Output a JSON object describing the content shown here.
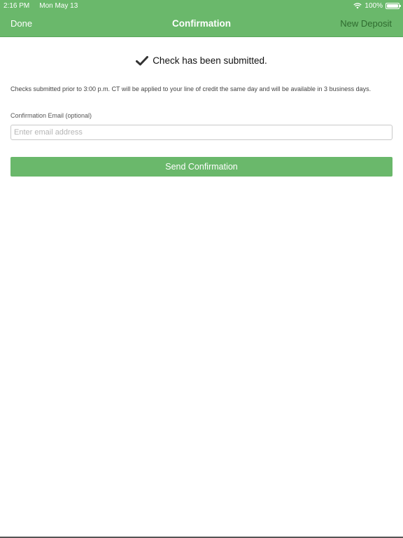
{
  "status_bar": {
    "time": "2:16 PM",
    "date": "Mon May 13",
    "battery": "100%",
    "icons": [
      "wifi-icon",
      "battery-icon"
    ]
  },
  "nav": {
    "left_label": "Done",
    "title": "Confirmation",
    "right_label": "New Deposit"
  },
  "confirmation": {
    "icon": "checkmark-icon",
    "message": "Check has been submitted.",
    "info": "Checks submitted prior to 3:00 p.m. CT will be applied to your line of credit the same day and will be available in 3 business days."
  },
  "email": {
    "label": "Confirmation Email (optional)",
    "placeholder": "Enter email address",
    "value": ""
  },
  "send_button": {
    "label": "Send Confirmation"
  },
  "colors": {
    "accent": "#6ab86b",
    "nav_right_text": "#2f6b2f"
  }
}
